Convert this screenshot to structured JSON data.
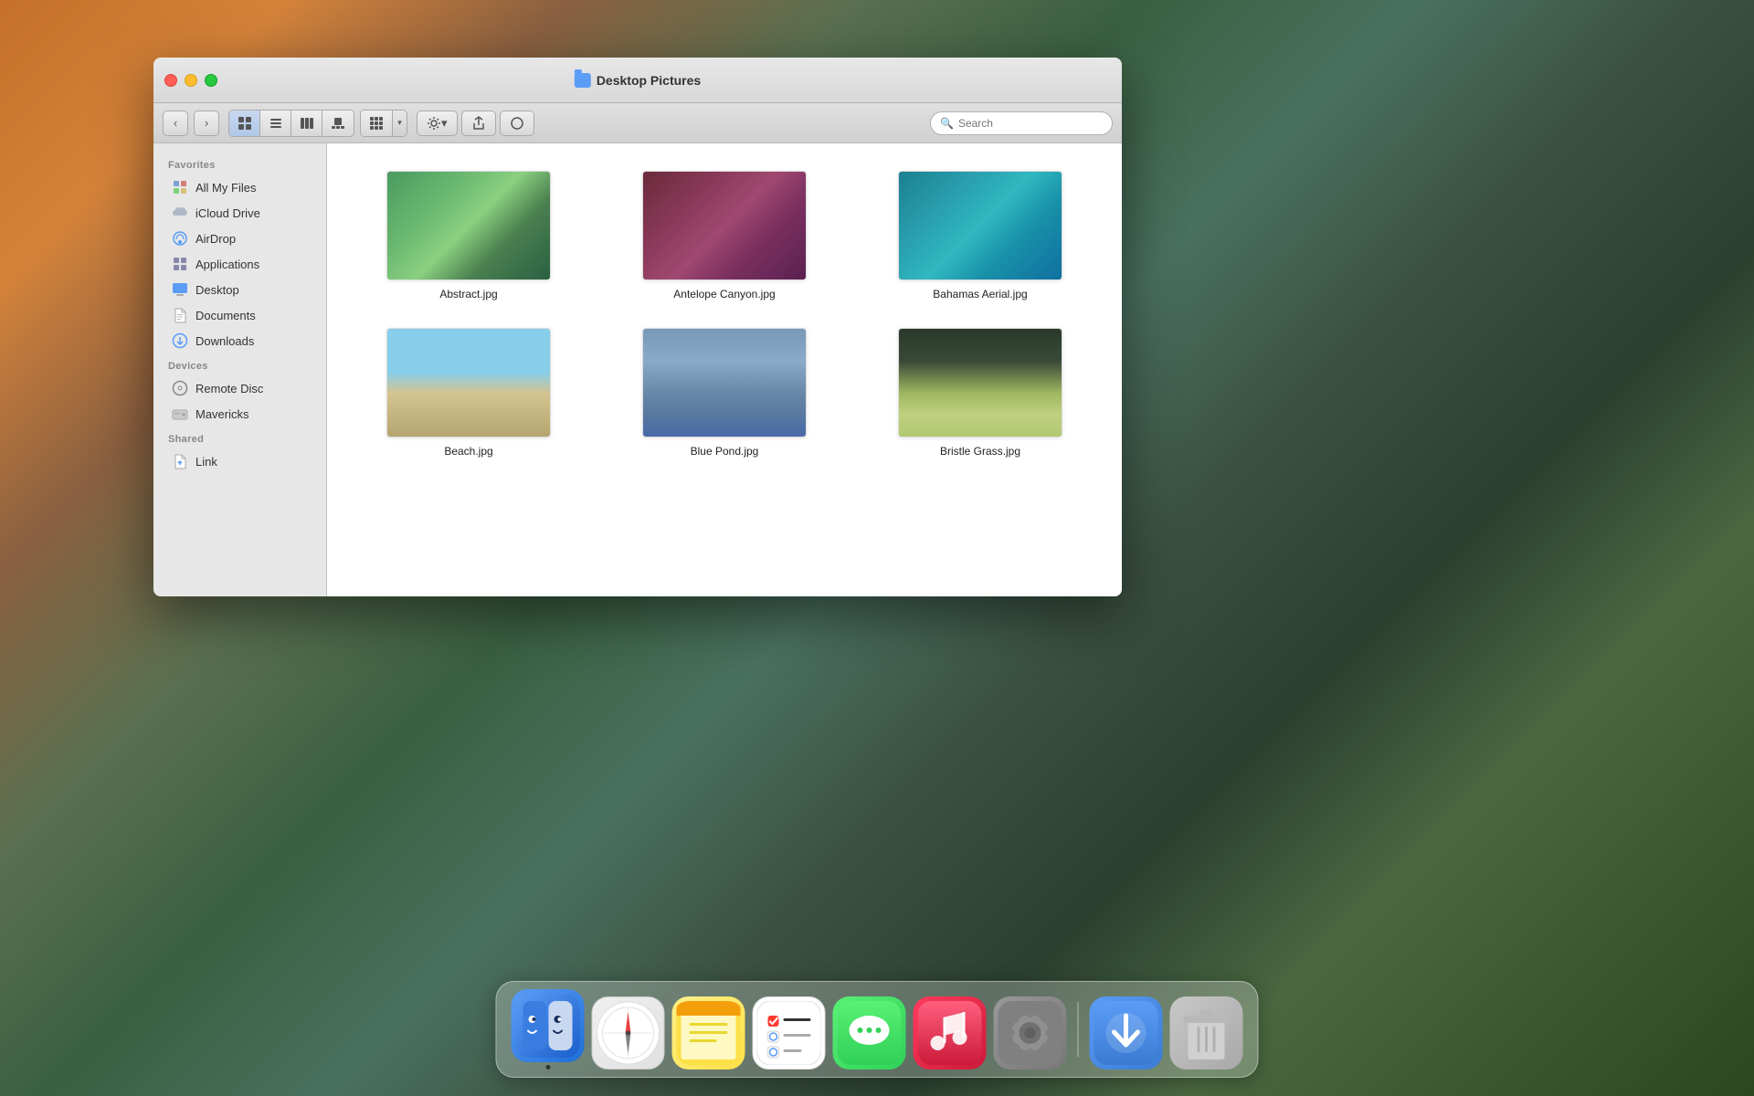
{
  "desktop": {
    "bg_description": "Yosemite mountain landscape"
  },
  "window": {
    "title": "Desktop Pictures",
    "close_label": "×",
    "minimize_label": "–",
    "maximize_label": "+"
  },
  "toolbar": {
    "back_label": "‹",
    "forward_label": "›",
    "view_icon": "⊞",
    "view_list": "☰",
    "view_columns": "⊟",
    "view_cover": "⊠",
    "view_grid_label": "⊞",
    "group_label": "⊞",
    "action_label": "⚙",
    "share_label": "↑",
    "tag_label": "◯",
    "search_placeholder": "Search"
  },
  "sidebar": {
    "favorites_label": "Favorites",
    "items_favorites": [
      {
        "id": "all-my-files",
        "label": "All My Files"
      },
      {
        "id": "icloud-drive",
        "label": "iCloud Drive"
      },
      {
        "id": "airdrop",
        "label": "AirDrop"
      },
      {
        "id": "applications",
        "label": "Applications"
      },
      {
        "id": "desktop",
        "label": "Desktop"
      },
      {
        "id": "documents",
        "label": "Documents"
      },
      {
        "id": "downloads",
        "label": "Downloads"
      }
    ],
    "devices_label": "Devices",
    "items_devices": [
      {
        "id": "remote-disc",
        "label": "Remote Disc"
      },
      {
        "id": "mavericks",
        "label": "Mavericks"
      }
    ],
    "shared_label": "Shared",
    "items_shared": [
      {
        "id": "link",
        "label": "Link"
      }
    ]
  },
  "files": [
    {
      "id": "abstract",
      "name": "Abstract.jpg",
      "thumb": "abstract"
    },
    {
      "id": "antelope",
      "name": "Antelope Canyon.jpg",
      "thumb": "antelope"
    },
    {
      "id": "bahamas",
      "name": "Bahamas Aerial.jpg",
      "thumb": "bahamas"
    },
    {
      "id": "beach",
      "name": "Beach.jpg",
      "thumb": "beach"
    },
    {
      "id": "bluepond",
      "name": "Blue Pond.jpg",
      "thumb": "bluepond"
    },
    {
      "id": "bristle",
      "name": "Bristle Grass.jpg",
      "thumb": "bristle"
    }
  ],
  "dock": {
    "items": [
      {
        "id": "finder",
        "label": "Finder",
        "has_dot": true
      },
      {
        "id": "safari",
        "label": "Safari",
        "has_dot": false
      },
      {
        "id": "notes",
        "label": "Notes",
        "has_dot": false
      },
      {
        "id": "reminders",
        "label": "Reminders",
        "has_dot": false
      },
      {
        "id": "messages",
        "label": "Messages",
        "has_dot": false
      },
      {
        "id": "itunes",
        "label": "iTunes",
        "has_dot": false
      },
      {
        "id": "syspref",
        "label": "System Preferences",
        "has_dot": false
      },
      {
        "id": "downloads-dock",
        "label": "Downloads",
        "has_dot": false
      },
      {
        "id": "trash",
        "label": "Trash",
        "has_dot": false
      }
    ]
  }
}
